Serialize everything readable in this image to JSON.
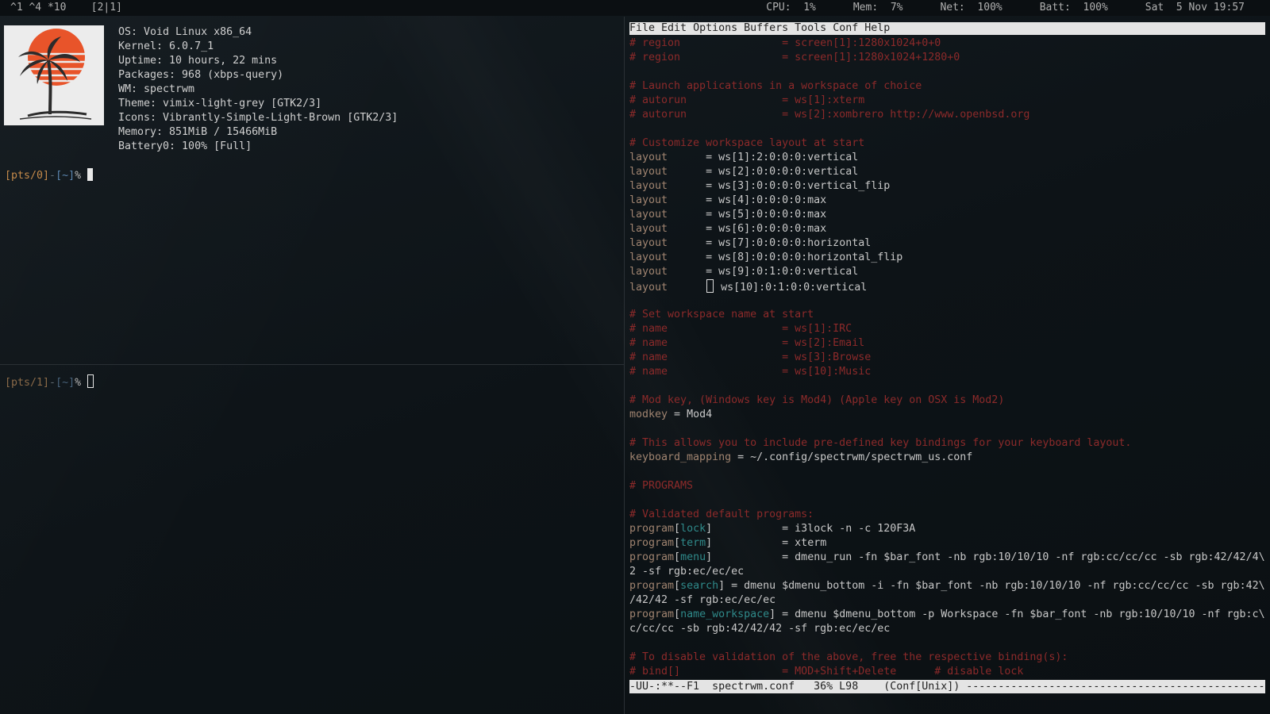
{
  "topbar": {
    "workspaces": "^1 ^4 *10",
    "layout": "[2|1]",
    "cpu": "CPU:  1%",
    "mem": "Mem:  7%",
    "net": "Net:  100%",
    "batt": "Batt:  100%",
    "clock": "Sat  5 Nov 19:57"
  },
  "neofetch": {
    "logo_icon": "palm-tree-sunset-logo",
    "os": "OS: Void Linux x86_64",
    "kernel": "Kernel: 6.0.7_1",
    "uptime": "Uptime: 10 hours, 22 mins",
    "packages": "Packages: 968 (xbps-query)",
    "wm": "WM: spectrwm",
    "theme": "Theme: vimix-light-grey [GTK2/3]",
    "icons": "Icons: Vibrantly-Simple-Light-Brown [GTK2/3]",
    "memory": "Memory: 851MiB / 15466MiB",
    "battery": "Battery0: 100% [Full]"
  },
  "term0": {
    "tty": "[pts/0]",
    "dash": "-",
    "dir": "[~]",
    "sym": "%"
  },
  "term1": {
    "tty": "[pts/1]",
    "dash": "-",
    "dir": "[~]",
    "sym": "%"
  },
  "emacs": {
    "menu": [
      "File",
      "Edit",
      "Options",
      "Buffers",
      "Tools",
      "Conf",
      "Help"
    ],
    "lines": [
      {
        "t": "cm",
        "s": "# region                = screen[1]:1280x1024+0+0"
      },
      {
        "t": "cm",
        "s": "# region                = screen[1]:1280x1024+1280+0"
      },
      {
        "t": "blank",
        "s": ""
      },
      {
        "t": "cm",
        "s": "# Launch applications in a workspace of choice"
      },
      {
        "t": "cm",
        "s": "# autorun               = ws[1]:xterm"
      },
      {
        "t": "cm",
        "s": "# autorun               = ws[2]:xombrero http://www.openbsd.org"
      },
      {
        "t": "blank",
        "s": ""
      },
      {
        "t": "cm",
        "s": "# Customize workspace layout at start"
      },
      {
        "t": "kv",
        "k": "layout",
        "s": "      = ws[1]:2:0:0:0:vertical"
      },
      {
        "t": "kv",
        "k": "layout",
        "s": "      = ws[2]:0:0:0:0:vertical"
      },
      {
        "t": "kv",
        "k": "layout",
        "s": "      = ws[3]:0:0:0:0:vertical_flip"
      },
      {
        "t": "kv",
        "k": "layout",
        "s": "      = ws[4]:0:0:0:0:max"
      },
      {
        "t": "kv",
        "k": "layout",
        "s": "      = ws[5]:0:0:0:0:max"
      },
      {
        "t": "kv",
        "k": "layout",
        "s": "      = ws[6]:0:0:0:0:max"
      },
      {
        "t": "kv",
        "k": "layout",
        "s": "      = ws[7]:0:0:0:0:horizontal"
      },
      {
        "t": "kv",
        "k": "layout",
        "s": "      = ws[8]:0:0:0:0:horizontal_flip"
      },
      {
        "t": "kv",
        "k": "layout",
        "s": "      = ws[9]:0:1:0:0:vertical"
      },
      {
        "t": "kvc",
        "k": "layout",
        "s": " ws[10]:0:1:0:0:vertical"
      },
      {
        "t": "blank",
        "s": ""
      },
      {
        "t": "cm",
        "s": "# Set workspace name at start"
      },
      {
        "t": "cm",
        "s": "# name                  = ws[1]:IRC"
      },
      {
        "t": "cm",
        "s": "# name                  = ws[2]:Email"
      },
      {
        "t": "cm",
        "s": "# name                  = ws[3]:Browse"
      },
      {
        "t": "cm",
        "s": "# name                  = ws[10]:Music"
      },
      {
        "t": "blank",
        "s": ""
      },
      {
        "t": "cm",
        "s": "# Mod key, (Windows key is Mod4) (Apple key on OSX is Mod2)"
      },
      {
        "t": "kv",
        "k": "modkey",
        "s": " = Mod4"
      },
      {
        "t": "blank",
        "s": ""
      },
      {
        "t": "cm",
        "s": "# This allows you to include pre-defined key bindings for your keyboard layout."
      },
      {
        "t": "kv",
        "k": "keyboard_mapping",
        "s": " = ~/.config/spectrwm/spectrwm_us.conf"
      },
      {
        "t": "blank",
        "s": ""
      },
      {
        "t": "cm",
        "s": "# PROGRAMS"
      },
      {
        "t": "blank",
        "s": ""
      },
      {
        "t": "cm",
        "s": "# Validated default programs:"
      },
      {
        "t": "prog",
        "k": "program",
        "b": "lock",
        "s": "           = i3lock -n -c 120F3A"
      },
      {
        "t": "prog",
        "k": "program",
        "b": "term",
        "s": "           = xterm"
      },
      {
        "t": "prog",
        "k": "program",
        "b": "menu",
        "s": "           = dmenu_run -fn $bar_font -nb rgb:10/10/10 -nf rgb:cc/cc/cc -sb rgb:42/42/4\\"
      },
      {
        "t": "plain",
        "s": "2 -sf rgb:ec/ec/ec"
      },
      {
        "t": "prog",
        "k": "program",
        "b": "search",
        "s": " = dmenu $dmenu_bottom -i -fn $bar_font -nb rgb:10/10/10 -nf rgb:cc/cc/cc -sb rgb:42\\"
      },
      {
        "t": "plain",
        "s": "/42/42 -sf rgb:ec/ec/ec"
      },
      {
        "t": "prog",
        "k": "program",
        "b": "name_workspace",
        "s": " = dmenu $dmenu_bottom -p Workspace -fn $bar_font -nb rgb:10/10/10 -nf rgb:c\\"
      },
      {
        "t": "plain",
        "s": "c/cc/cc -sb rgb:42/42/42 -sf rgb:ec/ec/ec"
      },
      {
        "t": "blank",
        "s": ""
      },
      {
        "t": "cm",
        "s": "# To disable validation of the above, free the respective binding(s):"
      },
      {
        "t": "cm",
        "s": "# bind[]                = MOD+Shift+Delete      # disable lock"
      }
    ],
    "modeline": "-UU-:**--F1  spectrwm.conf   36% L98    (Conf[Unix]) ---------------------------------------------------------"
  },
  "colors": {
    "comment": "#8c2a2a",
    "key": "#a08470",
    "bracket": "#2f8a8a",
    "prompt_orange": "#c48a4a",
    "prompt_blue": "#5b86b0"
  }
}
